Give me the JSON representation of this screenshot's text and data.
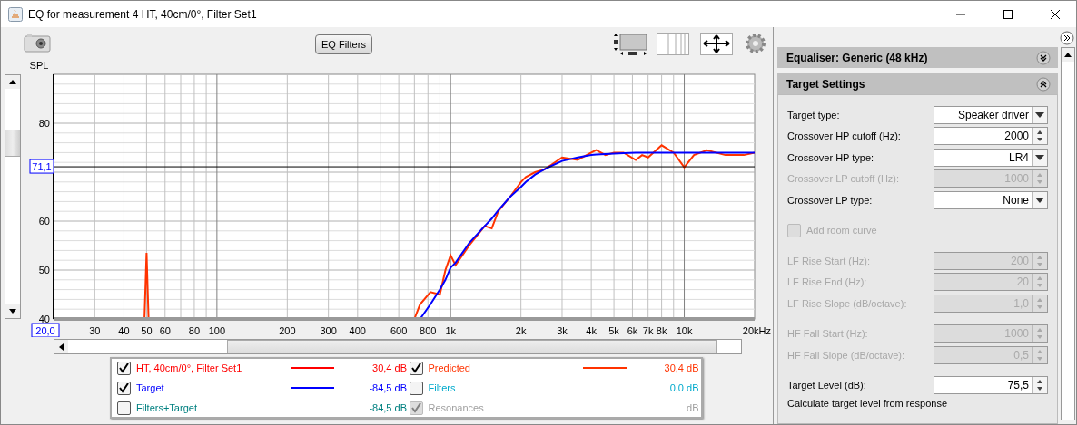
{
  "window": {
    "title": "EQ for measurement 4 HT, 40cm/0°, Filter Set1"
  },
  "toolbar": {
    "eq_button": "EQ Filters"
  },
  "graph": {
    "y_axis_title": "SPL",
    "y_labels": [
      "80",
      "60",
      "50",
      "40"
    ],
    "y_readout": "71,1",
    "x_readout": "20,0",
    "x_labels": [
      "30",
      "40",
      "50",
      "60",
      "80",
      "100",
      "200",
      "300",
      "400",
      "600",
      "800",
      "1k",
      "2k",
      "3k",
      "4k",
      "5k",
      "6k",
      "7k",
      "8k",
      "10k",
      "20kHz"
    ]
  },
  "legend": [
    {
      "name": "HT, 40cm/0°, Filter Set1",
      "color": "#ff0000",
      "checked": true,
      "disabled": false,
      "line": true,
      "value": "30,4 dB"
    },
    {
      "name": "Predicted",
      "color": "#ff3300",
      "checked": true,
      "disabled": false,
      "line": true,
      "value": "30,4 dB"
    },
    {
      "name": "Target",
      "color": "#0000ff",
      "checked": true,
      "disabled": false,
      "line": true,
      "value": "-84,5 dB"
    },
    {
      "name": "Filters",
      "color": "#00aacc",
      "checked": false,
      "disabled": false,
      "line": false,
      "value": "0,0 dB"
    },
    {
      "name": "Filters+Target",
      "color": "#008080",
      "checked": false,
      "disabled": false,
      "line": false,
      "value": "-84,5 dB"
    },
    {
      "name": "Resonances",
      "color": "#a0a0a0",
      "checked": true,
      "disabled": true,
      "line": false,
      "value": "dB"
    }
  ],
  "panel": {
    "sections": [
      {
        "title": "Equaliser: Generic (48 kHz)",
        "expanded": false
      },
      {
        "title": "Target Settings",
        "expanded": true
      }
    ],
    "fields": [
      {
        "kind": "dropdown",
        "label": "Target type:",
        "value": "Speaker driver",
        "disabled": false
      },
      {
        "kind": "spinner",
        "label": "Crossover HP cutoff (Hz):",
        "value": "2000",
        "disabled": false
      },
      {
        "kind": "dropdown",
        "label": "Crossover HP type:",
        "value": "LR4",
        "disabled": false
      },
      {
        "kind": "spinner",
        "label": "Crossover LP cutoff (Hz):",
        "value": "1000",
        "disabled": true
      },
      {
        "kind": "dropdown",
        "label": "Crossover LP type:",
        "value": "None",
        "disabled": false
      },
      {
        "kind": "checkbox",
        "label": "Add room curve",
        "checked": false,
        "disabled": true
      },
      {
        "kind": "spinner",
        "label": "LF Rise Start (Hz):",
        "value": "200",
        "disabled": true
      },
      {
        "kind": "spinner",
        "label": "LF Rise End (Hz):",
        "value": "20",
        "disabled": true
      },
      {
        "kind": "spinner",
        "label": "LF Rise Slope (dB/octave):",
        "value": "1,0",
        "disabled": true
      },
      {
        "kind": "spinner",
        "label": "HF Fall Start (Hz):",
        "value": "1000",
        "disabled": true
      },
      {
        "kind": "spinner",
        "label": "HF Fall Slope (dB/octave):",
        "value": "0,5",
        "disabled": true
      },
      {
        "kind": "spinner",
        "label": "Target Level (dB):",
        "value": "75,5",
        "disabled": false
      },
      {
        "kind": "note",
        "label": "Calculate target level from response"
      }
    ]
  }
}
